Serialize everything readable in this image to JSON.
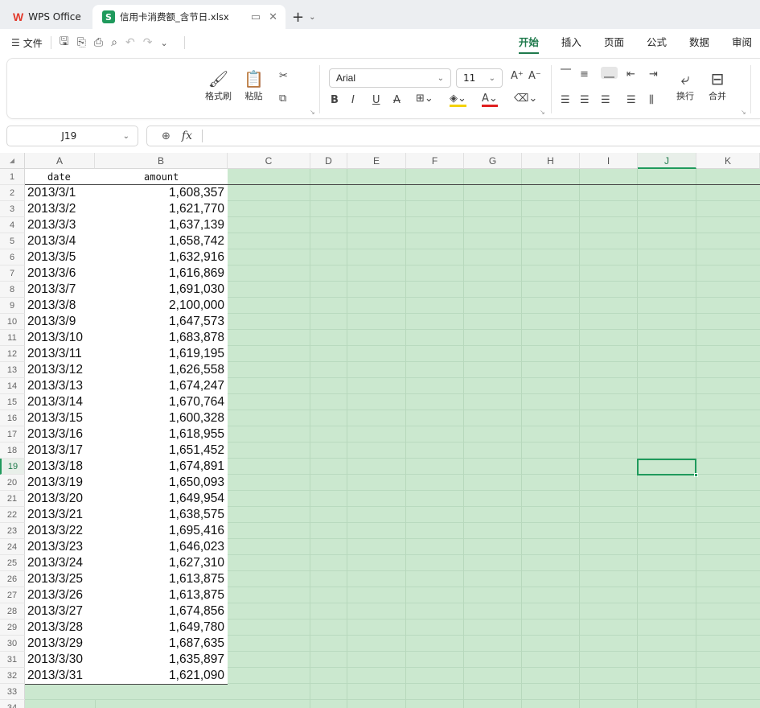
{
  "titlebar": {
    "app_tab": "WPS Office",
    "doc_tab": "信用卡消费额_含节日.xlsx",
    "doc_badge": "S"
  },
  "menubar": {
    "file_label": "文件",
    "ribbon_tabs": [
      "开始",
      "插入",
      "页面",
      "公式",
      "数据",
      "审阅"
    ],
    "active_tab": "开始"
  },
  "ribbon": {
    "format_painter": "格式刷",
    "paste": "粘贴",
    "font_name": "Arial",
    "font_size": "11",
    "wrap_text": "换行",
    "merge": "合并"
  },
  "formula_bar": {
    "cell_ref": "J19",
    "formula": ""
  },
  "columns": [
    "A",
    "B",
    "C",
    "D",
    "E",
    "F",
    "G",
    "H",
    "I",
    "J",
    "K"
  ],
  "selected_column": "J",
  "rows": [
    "1",
    "2",
    "3",
    "4",
    "5",
    "6",
    "7",
    "8",
    "9",
    "10",
    "11",
    "12",
    "13",
    "14",
    "15",
    "16",
    "17",
    "18",
    "19",
    "20",
    "21",
    "22",
    "23",
    "24",
    "25",
    "26",
    "27",
    "28",
    "29",
    "30",
    "31",
    "32",
    "33",
    "34"
  ],
  "selected_row": "19",
  "sheet": {
    "header": {
      "a": "date",
      "b": "amount"
    },
    "records": [
      {
        "date": "2013/3/1",
        "amount": "1,608,357"
      },
      {
        "date": "2013/3/2",
        "amount": "1,621,770"
      },
      {
        "date": "2013/3/3",
        "amount": "1,637,139"
      },
      {
        "date": "2013/3/4",
        "amount": "1,658,742"
      },
      {
        "date": "2013/3/5",
        "amount": "1,632,916"
      },
      {
        "date": "2013/3/6",
        "amount": "1,616,869"
      },
      {
        "date": "2013/3/7",
        "amount": "1,691,030"
      },
      {
        "date": "2013/3/8",
        "amount": "2,100,000"
      },
      {
        "date": "2013/3/9",
        "amount": "1,647,573"
      },
      {
        "date": "2013/3/10",
        "amount": "1,683,878"
      },
      {
        "date": "2013/3/11",
        "amount": "1,619,195"
      },
      {
        "date": "2013/3/12",
        "amount": "1,626,558"
      },
      {
        "date": "2013/3/13",
        "amount": "1,674,247"
      },
      {
        "date": "2013/3/14",
        "amount": "1,670,764"
      },
      {
        "date": "2013/3/15",
        "amount": "1,600,328"
      },
      {
        "date": "2013/3/16",
        "amount": "1,618,955"
      },
      {
        "date": "2013/3/17",
        "amount": "1,651,452"
      },
      {
        "date": "2013/3/18",
        "amount": "1,674,891"
      },
      {
        "date": "2013/3/19",
        "amount": "1,650,093"
      },
      {
        "date": "2013/3/20",
        "amount": "1,649,954"
      },
      {
        "date": "2013/3/21",
        "amount": "1,638,575"
      },
      {
        "date": "2013/3/22",
        "amount": "1,695,416"
      },
      {
        "date": "2013/3/23",
        "amount": "1,646,023"
      },
      {
        "date": "2013/3/24",
        "amount": "1,627,310"
      },
      {
        "date": "2013/3/25",
        "amount": "1,613,875"
      },
      {
        "date": "2013/3/26",
        "amount": "1,613,875"
      },
      {
        "date": "2013/3/27",
        "amount": "1,674,856"
      },
      {
        "date": "2013/3/28",
        "amount": "1,649,780"
      },
      {
        "date": "2013/3/29",
        "amount": "1,687,635"
      },
      {
        "date": "2013/3/30",
        "amount": "1,635,897"
      },
      {
        "date": "2013/3/31",
        "amount": "1,621,090"
      }
    ]
  },
  "colors": {
    "accent": "#1f9a5c",
    "sheet_background": "#cbe8cf",
    "wps_logo": "#e23a2c"
  }
}
